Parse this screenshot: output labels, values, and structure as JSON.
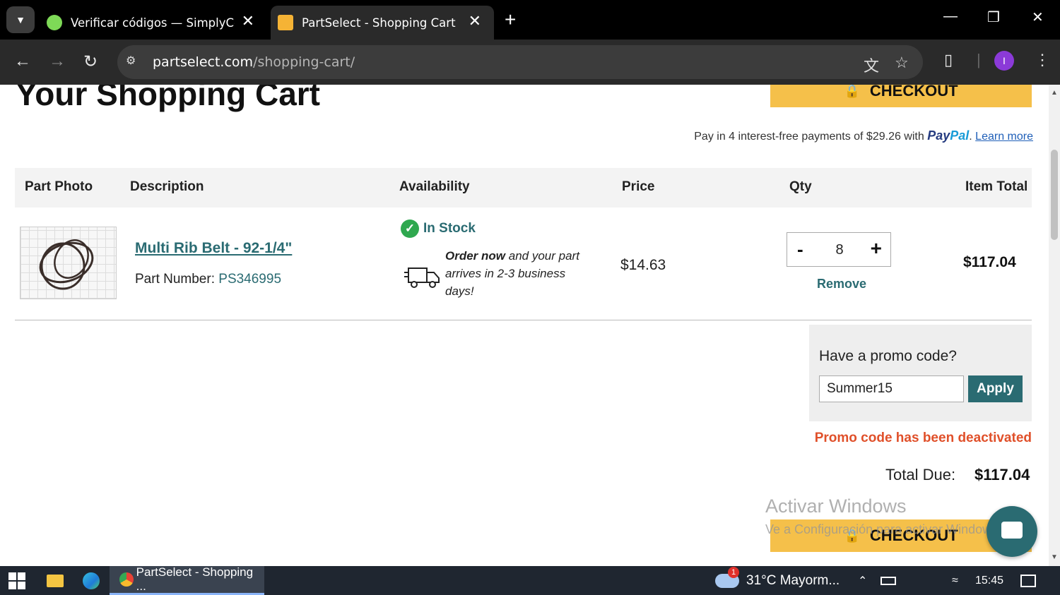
{
  "browser": {
    "tabs": [
      {
        "title": "Verificar códigos — SimplyCodes",
        "active": false
      },
      {
        "title": "PartSelect - Shopping Cart",
        "active": true
      }
    ],
    "url_domain": "partselect.com",
    "url_path": "/shopping-cart/",
    "profile_initial": "I"
  },
  "page": {
    "title": "Your Shopping Cart",
    "checkout_label": "CHECKOUT",
    "paypal": {
      "prefix": "Pay in 4 interest-free payments of $29.26 with",
      "logo_pay": "Pay",
      "logo_pal": "Pal",
      "link": "Learn more"
    },
    "columns": [
      "Part Photo",
      "Description",
      "Availability",
      "Price",
      "Qty",
      "Item Total"
    ],
    "item": {
      "name": "Multi Rib Belt - 92-1/4\"",
      "part_number_label": "Part Number:",
      "part_number": "PS346995",
      "availability": "In Stock",
      "shipping_bold": "Order now",
      "shipping_rest": " and your part arrives in 2-3 business days!",
      "price": "$14.63",
      "qty": "8",
      "remove_label": "Remove",
      "item_total": "$117.04"
    },
    "promo": {
      "label": "Have a promo code?",
      "value": "Summer15",
      "apply_label": "Apply",
      "error": "Promo code has been deactivated"
    },
    "total_label": "Total Due:",
    "total_value": "$117.04",
    "watermark_title": "Activar Windows",
    "watermark_sub": "Ve a Configuración para activar Windows."
  },
  "taskbar": {
    "app_label": "PartSelect - Shopping ...",
    "weather": "31°C  Mayorm...",
    "weather_badge": "1",
    "time": "15:45"
  },
  "colors": {
    "accent_teal": "#2a6b72",
    "checkout_yellow": "#f5c04a",
    "error": "#e0502a",
    "in_stock": "#2fa84f"
  }
}
